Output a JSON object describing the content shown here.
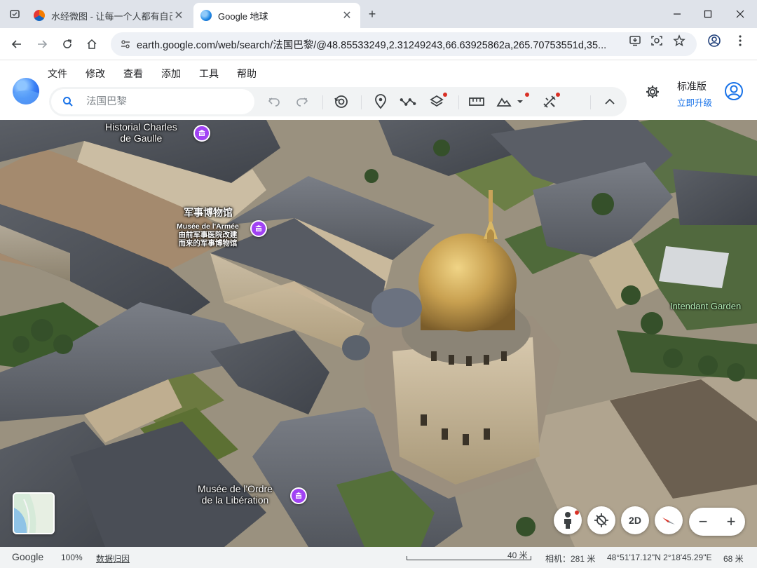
{
  "browser": {
    "tabs": [
      {
        "title": "水经微图 - 让每一个人都有自己",
        "favicon": "sjwt-icon"
      },
      {
        "title": "Google 地球",
        "favicon": "google-earth-icon"
      }
    ],
    "url": "earth.google.com/web/search/法国巴黎/@48.85533249,2.31249243,66.63925862a,265.70753551d,35..."
  },
  "app": {
    "menu": [
      "文件",
      "修改",
      "查看",
      "添加",
      "工具",
      "帮助"
    ],
    "search": {
      "placeholder": "法国巴黎"
    },
    "plan": {
      "name": "标准版",
      "upgrade": "立即升级"
    }
  },
  "map": {
    "labels": {
      "charles_de_gaulle": "Historial Charles\nde Gaulle",
      "museum_cn": "军事博物馆",
      "museum_sub": "Musée de l'Armée\n由前军事医院改建\n而来的军事博物馆",
      "liberation": "Musée de l'Ordre\nde la Libération",
      "garden": "Intendant Garden"
    },
    "controls": {
      "view_2d": "2D"
    }
  },
  "status": {
    "brand": "Google",
    "zoom": "100%",
    "attribution": "数据归因",
    "scale": "40 米",
    "camera": "相机：281 米",
    "coordinates": "48°51'17.12\"N 2°18'45.29\"E",
    "elevation": "68 米"
  },
  "colors": {
    "accent": "#1a73e8",
    "poi": "#a142f4",
    "notification": "#d93025"
  }
}
